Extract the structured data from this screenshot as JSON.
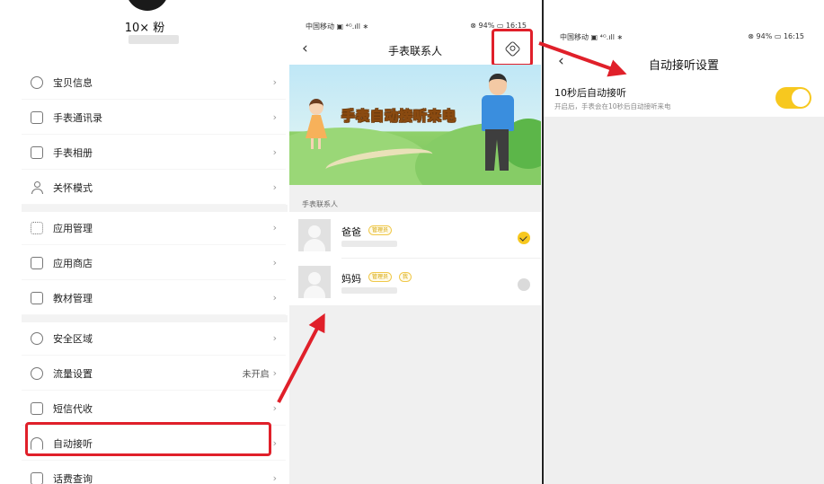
{
  "panel1": {
    "profile_name": "10× 粉",
    "menu_items": [
      {
        "label": "宝贝信息",
        "value": "",
        "icon": "face-icon"
      },
      {
        "label": "手表通讯录",
        "value": "",
        "icon": "contact-book-icon"
      },
      {
        "label": "手表相册",
        "value": "",
        "icon": "photo-icon"
      },
      {
        "label": "关怀模式",
        "value": "",
        "icon": "person-care-icon"
      },
      {
        "label": "应用管理",
        "value": "",
        "icon": "app-grid-icon"
      },
      {
        "label": "应用商店",
        "value": "",
        "icon": "store-icon"
      },
      {
        "label": "教材管理",
        "value": "",
        "icon": "book-icon"
      },
      {
        "label": "安全区域",
        "value": "",
        "icon": "shield-icon"
      },
      {
        "label": "流量设置",
        "value": "未开启",
        "icon": "data-flow-icon"
      },
      {
        "label": "短信代收",
        "value": "",
        "icon": "message-icon"
      },
      {
        "label": "自动接听",
        "value": "",
        "icon": "headset-icon"
      },
      {
        "label": "话费查询",
        "value": "",
        "icon": "bill-icon"
      }
    ],
    "chevron": "›"
  },
  "panel2": {
    "status_left": "中国移动 ▣ ⁴ᴳ.ıll ∗",
    "status_right": "⊗ 94% ▭ 16:15",
    "title": "手表联系人",
    "back": "‹",
    "banner_text": "手表自动接听来电",
    "section_label": "手表联系人",
    "contacts": [
      {
        "name": "爸爸",
        "badges": [
          "管理员"
        ],
        "selected": true
      },
      {
        "name": "妈妈",
        "badges": [
          "管理员",
          "我"
        ],
        "selected": false
      }
    ]
  },
  "panel3": {
    "status_left": "中国移动 ▣ ⁴ᴳ.ıll ∗",
    "status_right": "⊗ 94% ▭ 16:15",
    "back": "‹",
    "title": "自动接听设置",
    "setting_title": "10秒后自动接听",
    "setting_desc": "开启后，手表会在10秒后自动接听来电",
    "toggle_on": true
  },
  "colors": {
    "accent_yellow": "#f7c81f",
    "highlight_red": "#e0202a"
  }
}
